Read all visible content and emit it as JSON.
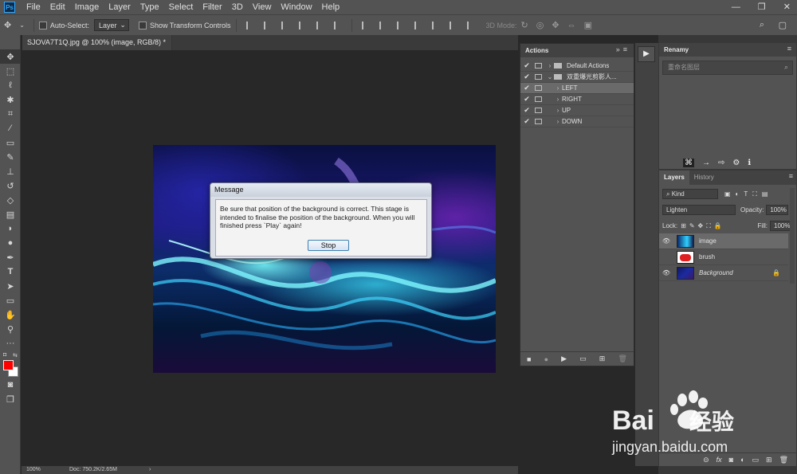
{
  "app": {
    "logo": "Ps"
  },
  "menu": [
    "File",
    "Edit",
    "Image",
    "Layer",
    "Type",
    "Select",
    "Filter",
    "3D",
    "View",
    "Window",
    "Help"
  ],
  "window_controls": {
    "minimize": "—",
    "maximize": "❐",
    "close": "✕"
  },
  "options": {
    "auto_select_label": "Auto-Select:",
    "auto_select_value": "Layer",
    "transform_label": "Show Transform Controls",
    "mode_label": "3D Mode:"
  },
  "document": {
    "tab_title": "SJOVA7T1Q.jpg @ 100% (image, RGB/8) *",
    "tab_close": "×"
  },
  "dialog": {
    "title": "Message",
    "message": "Be sure that position of the background is correct. This stage is intended to finalise the position of the background. When you will finished press `Play` again!",
    "button": "Stop"
  },
  "actions": {
    "tab": "Actions",
    "rows": [
      {
        "label": "Default Actions",
        "folder": true,
        "expanded": false,
        "selected": false
      },
      {
        "label": "双重爆光剪影人...",
        "folder": true,
        "expanded": true,
        "selected": false
      },
      {
        "label": "LEFT",
        "folder": false,
        "selected": true
      },
      {
        "label": "RIGHT",
        "folder": false,
        "selected": false
      },
      {
        "label": "UP",
        "folder": false,
        "selected": false
      },
      {
        "label": "DOWN",
        "folder": false,
        "selected": false
      }
    ]
  },
  "renamy": {
    "tab": "Renamy",
    "placeholder": "重命名图层"
  },
  "layers": {
    "tabs": [
      "Layers",
      "History"
    ],
    "kind": "Kind",
    "blend_mode": "Lighten",
    "opacity_label": "Opacity:",
    "opacity": "100%",
    "lock_label": "Lock:",
    "fill_label": "Fill:",
    "fill": "100%",
    "items": [
      {
        "name": "image",
        "visible": true,
        "selected": true,
        "italic": false
      },
      {
        "name": "brush",
        "visible": false,
        "selected": false,
        "italic": false
      },
      {
        "name": "Background",
        "visible": true,
        "selected": false,
        "italic": true,
        "locked": true
      }
    ]
  },
  "status": {
    "zoom": "100%",
    "doc": "Doc: 750.2K/2.65M"
  },
  "watermark": {
    "brand": "Bai",
    "brand_suffix": "经验",
    "url": "jingyan.baidu.com"
  }
}
